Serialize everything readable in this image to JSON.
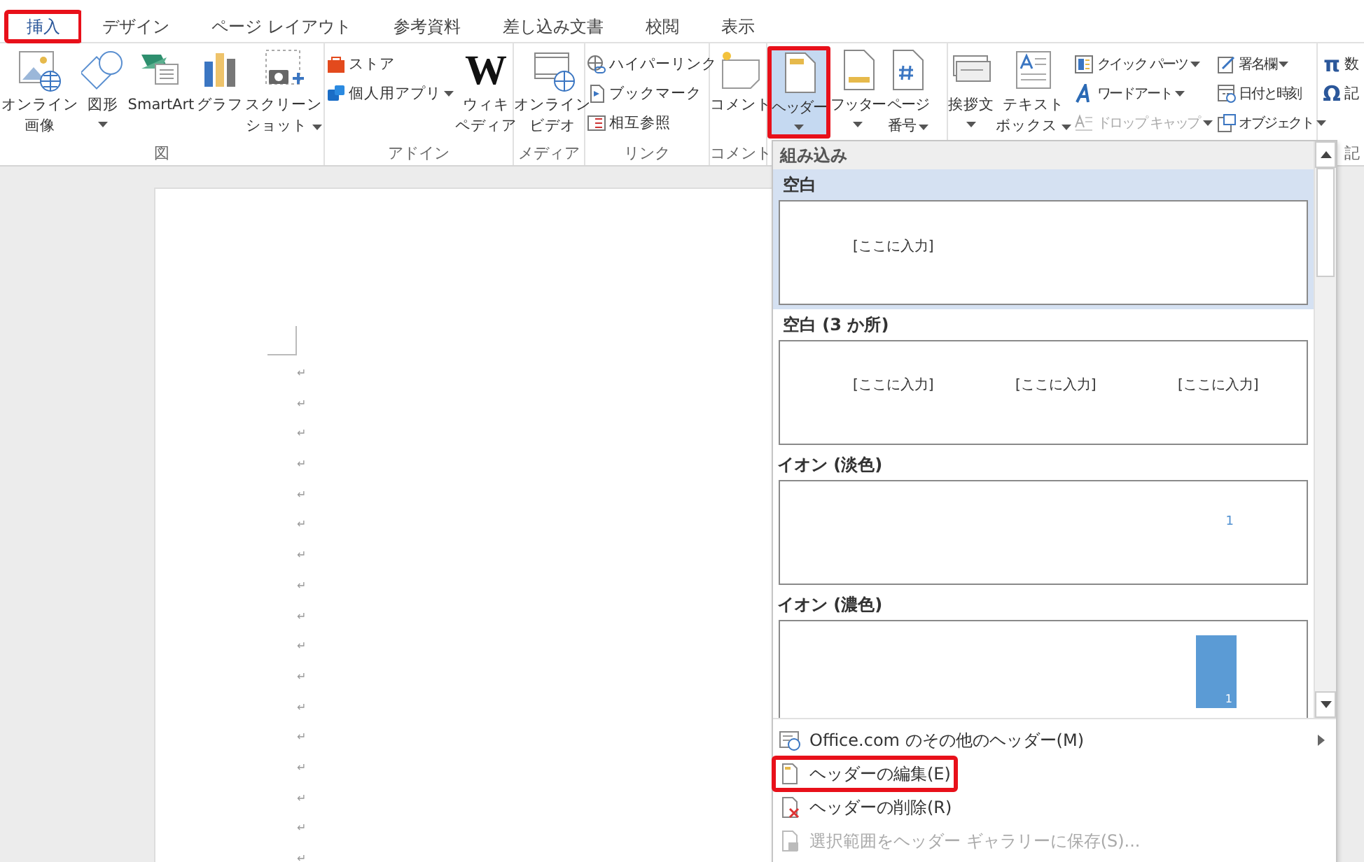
{
  "tabs": [
    {
      "label": "挿入",
      "selected": true,
      "annotated": true
    },
    {
      "label": "デザイン",
      "selected": false,
      "annotated": false
    },
    {
      "label": "ページ レイアウト",
      "selected": false,
      "annotated": false
    },
    {
      "label": "参考資料",
      "selected": false,
      "annotated": false
    },
    {
      "label": "差し込み文書",
      "selected": false,
      "annotated": false
    },
    {
      "label": "校閲",
      "selected": false,
      "annotated": false
    },
    {
      "label": "表示",
      "selected": false,
      "annotated": false
    }
  ],
  "ribbon": {
    "groups": [
      {
        "label": "図",
        "items": [
          {
            "kind": "large",
            "lines": [
              "オンライン",
              "画像"
            ]
          },
          {
            "kind": "large",
            "lines": [
              "図形"
            ],
            "dropdown": true
          },
          {
            "kind": "large",
            "lines": [
              "SmartArt"
            ]
          },
          {
            "kind": "large",
            "lines": [
              "グラフ"
            ]
          },
          {
            "kind": "large",
            "lines": [
              "スクリーン",
              "ショット"
            ],
            "dropdown": true
          }
        ]
      },
      {
        "label": "アドイン",
        "items": [
          {
            "kind": "stack",
            "items": [
              {
                "label": "ストア"
              },
              {
                "label": "個人用アプリ",
                "dropdown": true
              }
            ]
          },
          {
            "kind": "large",
            "glyph": "W",
            "lines": [
              "ウィキ",
              "ペディア"
            ]
          }
        ]
      },
      {
        "label": "メディア",
        "items": [
          {
            "kind": "large",
            "lines": [
              "オンライン",
              "ビデオ"
            ]
          }
        ]
      },
      {
        "label": "リンク",
        "items": [
          {
            "kind": "stack",
            "items": [
              {
                "label": "ハイパーリンク"
              },
              {
                "label": "ブックマーク"
              },
              {
                "label": "相互参照"
              }
            ]
          }
        ]
      },
      {
        "label": "コメント",
        "items": [
          {
            "kind": "large",
            "lines": [
              "コメント"
            ]
          }
        ]
      },
      {
        "items": [
          {
            "kind": "large",
            "lines": [
              "ヘッダー"
            ],
            "dropdown": true,
            "pressed": true,
            "annotated": true
          },
          {
            "kind": "large",
            "lines": [
              "フッター"
            ],
            "dropdown": true,
            "pressed": false,
            "annotated": false
          },
          {
            "kind": "large",
            "lines": [
              "ページ",
              "番号"
            ],
            "dropdown": true,
            "pressed": false,
            "annotated": false
          }
        ]
      },
      {
        "items": [
          {
            "kind": "large",
            "lines": [
              "挨拶文"
            ],
            "dropdown": true
          },
          {
            "kind": "large",
            "lines": [
              "テキスト",
              "ボックス"
            ],
            "dropdown": true
          },
          {
            "kind": "stack",
            "items": [
              {
                "label": "クイック パーツ",
                "dropdown": true,
                "disabled": false
              },
              {
                "label": "ワードアート",
                "dropdown": true,
                "disabled": false
              },
              {
                "label": "ドロップ キャップ",
                "dropdown": true,
                "disabled": true
              }
            ]
          },
          {
            "kind": "stack",
            "items": [
              {
                "label": "署名欄",
                "dropdown": true
              },
              {
                "label": "日付と時刻"
              },
              {
                "label": "オブジェクト",
                "dropdown": true
              }
            ]
          }
        ]
      },
      {
        "label": "記",
        "items": [
          {
            "kind": "stack",
            "items": [
              {
                "glyph": "π",
                "label": "数"
              },
              {
                "glyph": "Ω",
                "label": "記"
              }
            ]
          }
        ]
      }
    ]
  },
  "document": {
    "paragraph_marks": [
      "↵",
      "↵",
      "↵",
      "↵",
      "↵",
      "↵",
      "↵",
      "↵",
      "↵",
      "↵",
      "↵",
      "↵",
      "↵",
      "↵",
      "↵",
      "↵",
      "↵"
    ]
  },
  "header_dropdown": {
    "section": "組み込み",
    "gallery": [
      {
        "title": "空白",
        "selected": true,
        "kind": "blank",
        "fields": [
          "[ここに入力]"
        ]
      },
      {
        "title": "空白 (3 か所)",
        "selected": false,
        "kind": "blank3",
        "fields": [
          "[ここに入力]",
          "[ここに入力]",
          "[ここに入力]"
        ]
      },
      {
        "title": "イオン (淡色)",
        "selected": false,
        "kind": "ion-light",
        "fields": [
          "1"
        ]
      },
      {
        "title": "イオン (濃色)",
        "selected": false,
        "kind": "ion-dark",
        "fields": [
          "1"
        ]
      }
    ],
    "menu": [
      {
        "label": "Office.com のその他のヘッダー(M)",
        "submenu": true,
        "disabled": false,
        "annotated": false
      },
      {
        "label": "ヘッダーの編集(E)",
        "submenu": false,
        "disabled": false,
        "annotated": true
      },
      {
        "label": "ヘッダーの削除(R)",
        "submenu": false,
        "disabled": false,
        "annotated": false
      },
      {
        "label": "選択範囲をヘッダー ギャラリーに保存(S)...",
        "submenu": false,
        "disabled": true,
        "annotated": false
      }
    ]
  }
}
